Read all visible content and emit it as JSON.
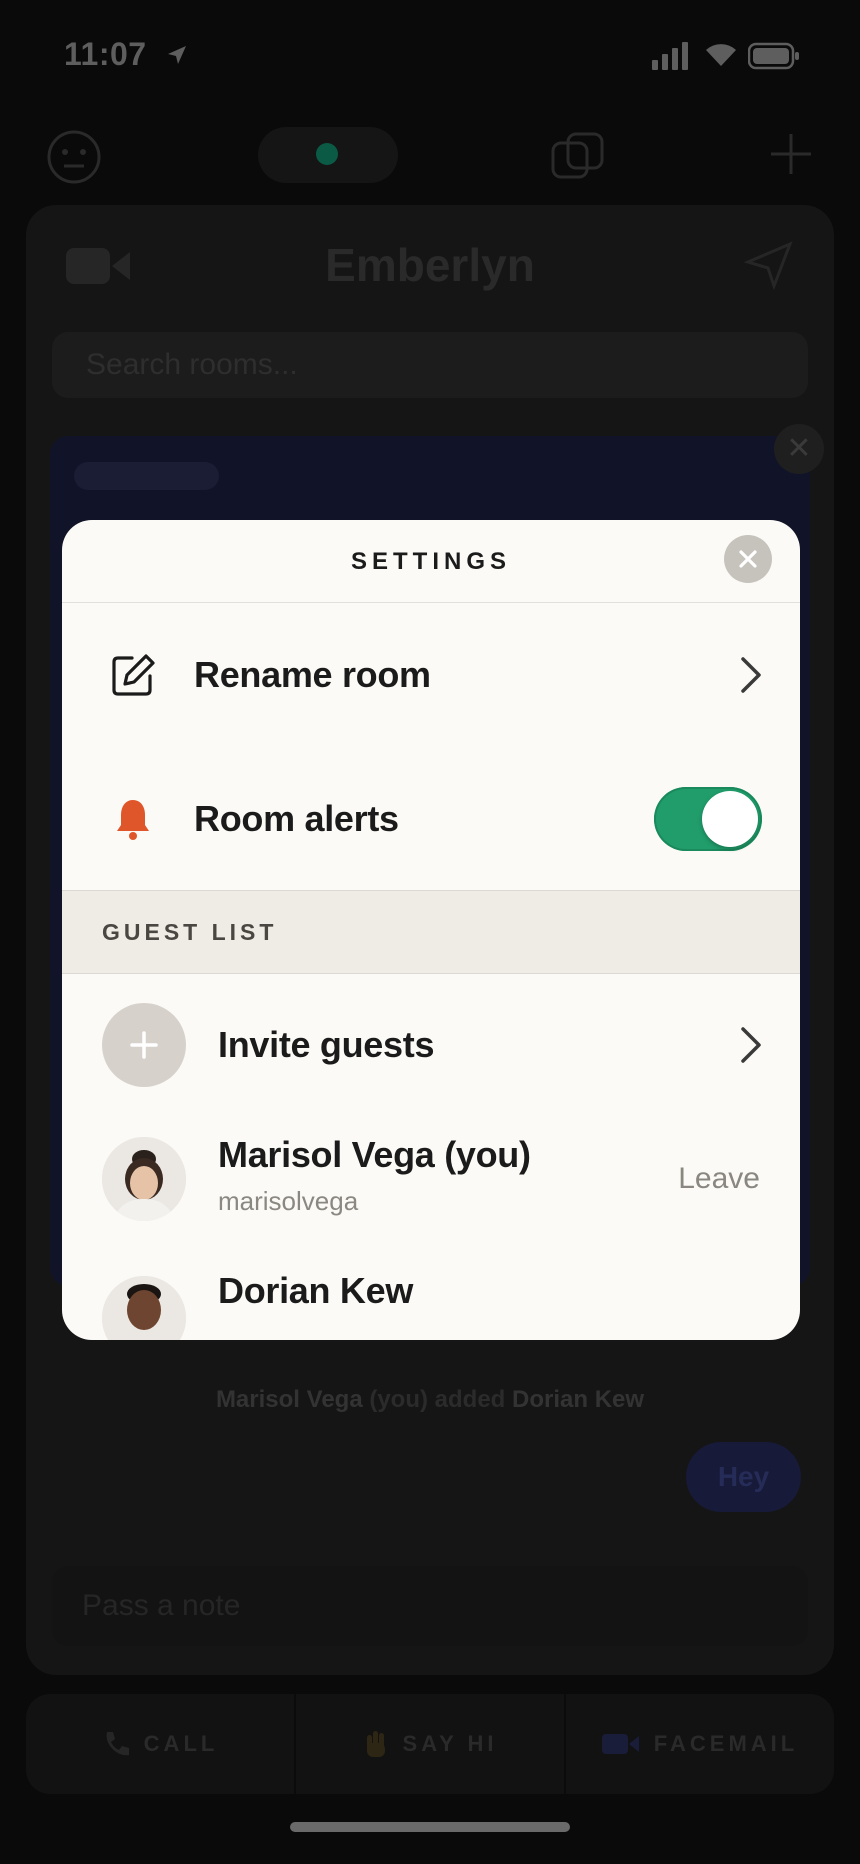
{
  "status_bar": {
    "time": "11:07"
  },
  "background": {
    "room_title": "Emberlyn",
    "search_placeholder": "Search rooms...",
    "system_messages": [
      {
        "actor": "Marisol Vega",
        "middle": " (you) added ",
        "target": "Dorian Kew"
      }
    ],
    "chat_bubble": "Hey",
    "note_placeholder": "Pass a note",
    "bottom_actions": [
      {
        "label": "CALL",
        "icon": "phone-icon"
      },
      {
        "label": "SAY HI",
        "icon": "hand-icon"
      },
      {
        "label": "FACEMAIL",
        "icon": "video-icon"
      }
    ]
  },
  "settings": {
    "title": "SETTINGS",
    "rename_label": "Rename room",
    "alerts_label": "Room alerts",
    "alerts_enabled": true,
    "guest_list_header": "GUEST LIST",
    "invite_label": "Invite guests",
    "guests": [
      {
        "name": "Marisol Vega (you)",
        "username": "marisolvega",
        "action": "Leave"
      },
      {
        "name": "Dorian Kew"
      }
    ]
  },
  "colors": {
    "toggle_on": "#209d6a",
    "bell": "#e0562b",
    "modal_bg": "#fbfaf6",
    "section_bg": "#efece5"
  }
}
